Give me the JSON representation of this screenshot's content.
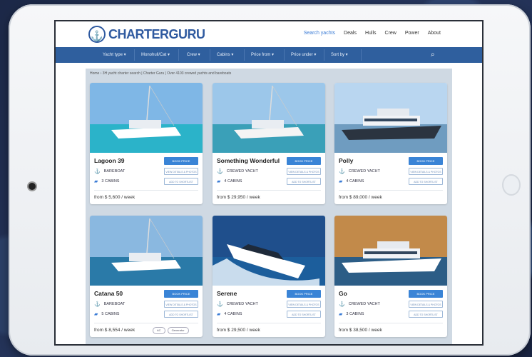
{
  "brand": {
    "name": "CHARTERGURU",
    "colors": {
      "primary": "#2f5f9e",
      "accent": "#3a84d6"
    }
  },
  "top_nav": [
    "Search yachts",
    "Deals",
    "Hulls",
    "Crew",
    "Power",
    "About"
  ],
  "filters": [
    "Yacht type",
    "Monohull/Cat",
    "Crew",
    "Cabins",
    "Price from",
    "Price under",
    "Sort by"
  ],
  "breadcrumb": "Home › 3H yacht charter search | Charter Guru | Over 4103 crewed yachts and bareboats",
  "cards": [
    {
      "name": "Lagoon 39",
      "type": "BAREBOAT",
      "cabins": "3 CABINS",
      "price": "from $ 5,600 / week",
      "tags": []
    },
    {
      "name": "Something Wonderful",
      "type": "CREWED YACHT",
      "cabins": "4 CABINS",
      "price": "from $ 29,950 / week",
      "tags": []
    },
    {
      "name": "Polly",
      "type": "CREWED YACHT",
      "cabins": "4 CABINS",
      "price": "from $ 89,000 / week",
      "tags": []
    },
    {
      "name": "Catana 50",
      "type": "BAREBOAT",
      "cabins": "5 CABINS",
      "price": "from $ 8,554 / week",
      "tags": [
        "AC",
        "Generator"
      ]
    },
    {
      "name": "Serene",
      "type": "CREWED YACHT",
      "cabins": "4 CABINS",
      "price": "from $ 29,500 / week",
      "tags": []
    },
    {
      "name": "Go",
      "type": "CREWED YACHT",
      "cabins": "3 CABINS",
      "price": "from $ 38,500 / week",
      "tags": []
    }
  ],
  "card_buttons": {
    "primary": "BOOK PRICE",
    "details": "VIEW DETAILS & PHOTOS",
    "shortlist": "ADD TO SHORTLIST"
  }
}
